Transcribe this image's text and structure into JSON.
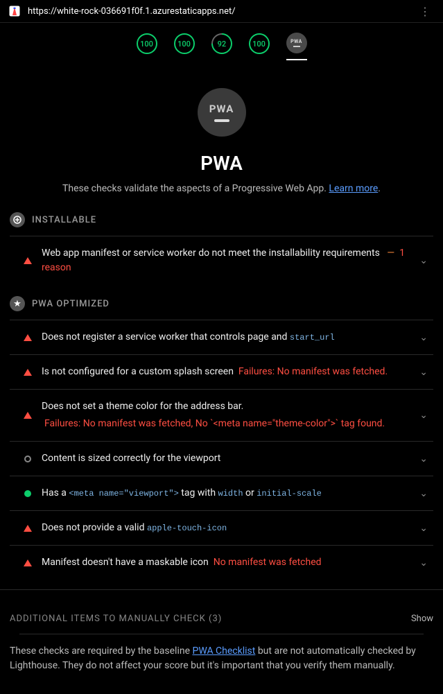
{
  "topbar": {
    "url": "https://white-rock-036691f0f.1.azurestaticapps.net/"
  },
  "tabs": {
    "scores": [
      "100",
      "100",
      "92",
      "100"
    ],
    "pwa_label": "PWA"
  },
  "hero": {
    "badge_text": "PWA",
    "title": "PWA",
    "desc_prefix": "These checks validate the aspects of a Progressive Web App. ",
    "link": "Learn more",
    "desc_suffix": "."
  },
  "groups": {
    "installable": {
      "title": "INSTALLABLE",
      "audits": [
        {
          "status": "red",
          "text": "Web app manifest or service worker do not meet the installability requirements",
          "dash": "—",
          "reason": "1 reason"
        }
      ]
    },
    "optimized": {
      "title": "PWA OPTIMIZED",
      "audits": [
        {
          "status": "red",
          "pre": "Does not register a service worker that controls page and ",
          "code": "start_url"
        },
        {
          "status": "red",
          "text": "Is not configured for a custom splash screen",
          "fail": "Failures: No manifest was fetched."
        },
        {
          "status": "red",
          "text": "Does not set a theme color for the address bar.",
          "fail_block": "Failures: No manifest was fetched, No `<meta name=\"theme-color\">` tag found."
        },
        {
          "status": "gray",
          "text": "Content is sized correctly for the viewport"
        },
        {
          "status": "green",
          "parts": {
            "p1": "Has a ",
            "c1": "<meta name=\"viewport\">",
            "p2": " tag with ",
            "c2": "width",
            "p3": " or ",
            "c3": "initial-scale"
          }
        },
        {
          "status": "red",
          "pre": "Does not provide a valid ",
          "code": "apple-touch-icon"
        },
        {
          "status": "red",
          "text": "Manifest doesn't have a maskable icon",
          "fail": "No manifest was fetched"
        }
      ]
    }
  },
  "additional": {
    "title": "ADDITIONAL ITEMS TO MANUALLY CHECK",
    "count": "(3)",
    "show": "Show",
    "desc_p1": "These checks are required by the baseline ",
    "link": "PWA Checklist",
    "desc_p2": " but are not automatically checked by Lighthouse. They do not affect your score but it's important that you verify them manually."
  }
}
